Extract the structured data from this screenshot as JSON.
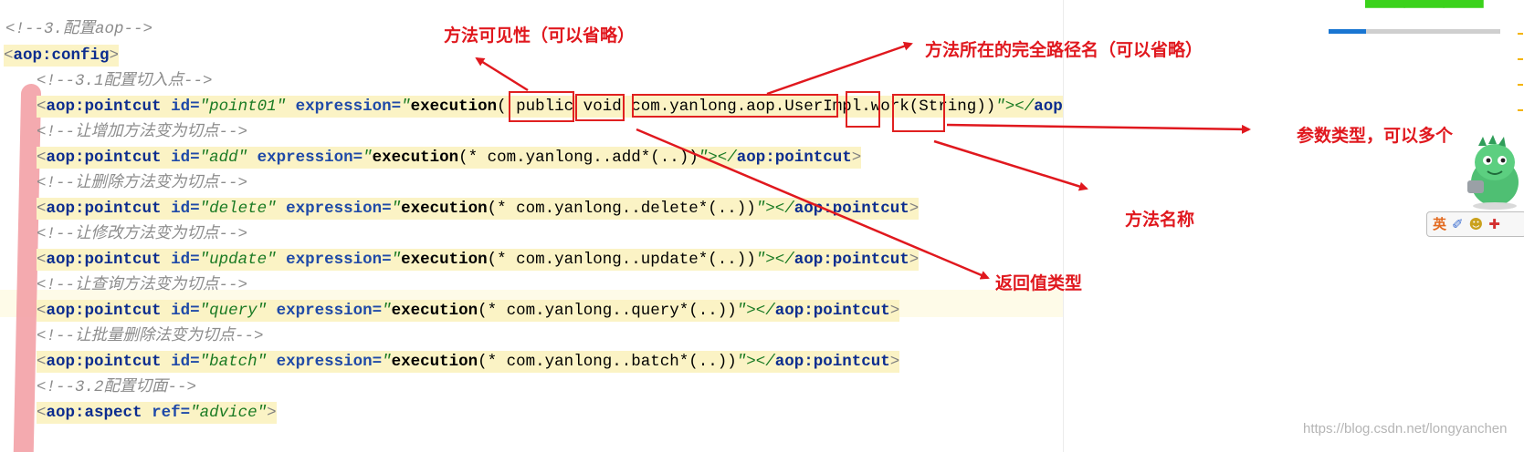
{
  "code": {
    "c1": "<!--3.配置aop-->",
    "cfg_open": "<",
    "cfg_tag": "aop:config",
    "cfg_close": ">",
    "c2": "<!--3.1配置切入点-->",
    "l1": {
      "a": "<",
      "tag": "aop:pointcut",
      "sp1": " ",
      "id_attr": "id=",
      "id_val": "\"point01\"",
      "sp2": " ",
      "expr_attr": "expression=",
      "q": "\"",
      "exec": "execution",
      "rest": "( public void com.yanlong.aop.UserImpl.work(String))",
      "end": "\"></",
      "etag": "aop:pointcut",
      "gt": ">"
    },
    "c3": "<!--让增加方法变为切点-->",
    "l2": {
      "a": "<",
      "tag": "aop:pointcut",
      "sp1": " ",
      "id_attr": "id=",
      "id_val": "\"add\"",
      "sp2": " ",
      "expr_attr": "expression=",
      "q": "\"",
      "exec": "execution",
      "rest": "(* com.yanlong..add*(..))",
      "end": "\"></",
      "etag": "aop:pointcut",
      "gt": ">"
    },
    "c4": "<!--让删除方法变为切点-->",
    "l3": {
      "a": "<",
      "tag": "aop:pointcut",
      "sp1": " ",
      "id_attr": "id=",
      "id_val": "\"delete\"",
      "sp2": " ",
      "expr_attr": "expression=",
      "q": "\"",
      "exec": "execution",
      "rest": "(* com.yanlong..delete*(..))",
      "end": "\"></",
      "etag": "aop:pointcut",
      "gt": ">"
    },
    "c5": "<!--让修改方法变为切点-->",
    "l4": {
      "a": "<",
      "tag": "aop:pointcut",
      "sp1": " ",
      "id_attr": "id=",
      "id_val": "\"update\"",
      "sp2": " ",
      "expr_attr": "expression=",
      "q": "\"",
      "exec": "execution",
      "rest": "(* com.yanlong..update*(..))",
      "end": "\"></",
      "etag": "aop:pointcut",
      "gt": ">"
    },
    "c6": "<!--让查询方法变为切点-->",
    "l5": {
      "a": "<",
      "tag": "aop:pointcut",
      "sp1": " ",
      "id_attr": "id=",
      "id_val": "\"query\"",
      "sp2": " ",
      "expr_attr": "expression=",
      "q": "\"",
      "exec": "execution",
      "rest": "(* com.yanlong..query*(..))",
      "end": "\"></",
      "etag": "aop:pointcut",
      "gt": ">"
    },
    "c7": "<!--让批量删除法变为切点-->",
    "l6": {
      "a": "<",
      "tag": "aop:pointcut",
      "sp1": " ",
      "id_attr": "id=",
      "id_val": "\"batch\"",
      "sp2": " ",
      "expr_attr": "expression=",
      "q": "\"",
      "exec": "execution",
      "rest": "(* com.yanlong..batch*(..))",
      "end": "\"></",
      "etag": "aop:pointcut",
      "gt": ">"
    },
    "c8": "<!--3.2配置切面-->",
    "l7": {
      "a": "<",
      "tag": "aop:aspect",
      "sp1": " ",
      "ref_attr": "ref=",
      "ref_val": "\"advice\"",
      "gt": ">"
    }
  },
  "annotations": {
    "visibility": "方法可见性（可以省略）",
    "path": "方法所在的完全路径名（可以省略）",
    "params": "参数类型，可以多个",
    "method_name": "方法名称",
    "return_type": "返回值类型"
  },
  "sidebar": {
    "ime_icons": [
      "英",
      "✐",
      "☻",
      "✚"
    ],
    "progress": 0.22
  },
  "watermark": "https://blog.csdn.net/longyanchen",
  "colors": {
    "annotation": "#e0181e",
    "tag_bg": "#fbf3c5",
    "tag_name": "#0c2d8f"
  }
}
